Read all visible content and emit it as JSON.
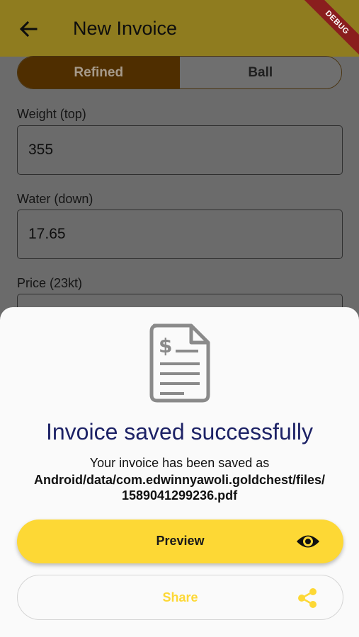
{
  "appbar": {
    "title": "New Invoice",
    "debug_label": "DEBUG"
  },
  "segment": {
    "options": [
      "Refined",
      "Ball"
    ],
    "selected": "Refined"
  },
  "fields": [
    {
      "label": "Weight (top)",
      "value": "355"
    },
    {
      "label": "Water (down)",
      "value": "17.65"
    },
    {
      "label": "Price (23kt)",
      "value": ""
    }
  ],
  "sheet": {
    "title": "Invoice saved successfully",
    "subtitle": "Your invoice has been saved as",
    "path_line1": "Android/data/com.edwinnyawoli.goldchest/files/",
    "path_line2": "1589041299236.pdf",
    "preview_label": "Preview",
    "share_label": "Share"
  },
  "icons": {
    "back": "arrow-back-icon",
    "document": "invoice-document-icon",
    "preview": "eye-icon",
    "share": "share-icon"
  },
  "colors": {
    "accent": "#fdd835",
    "appbar_dimmed": "#8f7c1f",
    "title_text": "#1d2266",
    "segment_active": "#4f2e00"
  }
}
